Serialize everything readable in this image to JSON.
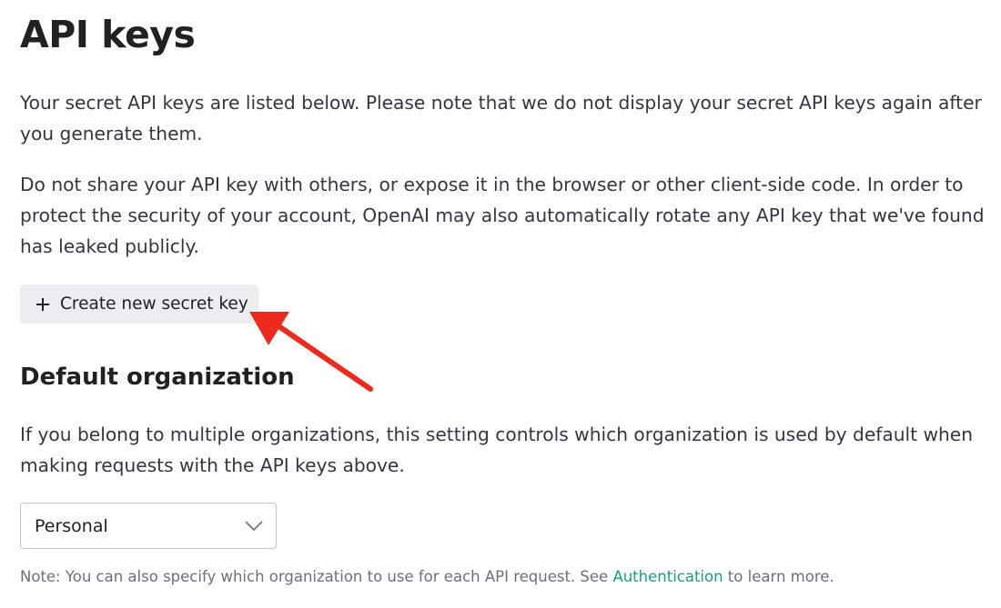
{
  "page": {
    "title": "API keys",
    "intro": "Your secret API keys are listed below. Please note that we do not display your secret API keys again after you generate them.",
    "warning": "Do not share your API key with others, or expose it in the browser or other client-side code. In order to protect the security of your account, OpenAI may also automatically rotate any API key that we've found has leaked publicly.",
    "create_button": {
      "icon": "plus-icon",
      "label": "Create new secret key"
    },
    "annotation": {
      "icon": "red-arrow",
      "color": "#ee2a1f"
    }
  },
  "default_org": {
    "heading": "Default organization",
    "description": "If you belong to multiple organizations, this setting controls which organization is used by default when making requests with the API keys above.",
    "select": {
      "value": "Personal",
      "icon": "chevron-down-icon"
    },
    "note": {
      "prefix": "Note: You can also specify which organization to use for each API request. See ",
      "link": "Authentication",
      "suffix": " to learn more."
    }
  },
  "colors": {
    "text": "#202123",
    "body_text": "#353740",
    "muted": "#6e6e80",
    "button_bg": "#ececf1",
    "link": "#10a37f",
    "border": "#c5c5d2"
  }
}
